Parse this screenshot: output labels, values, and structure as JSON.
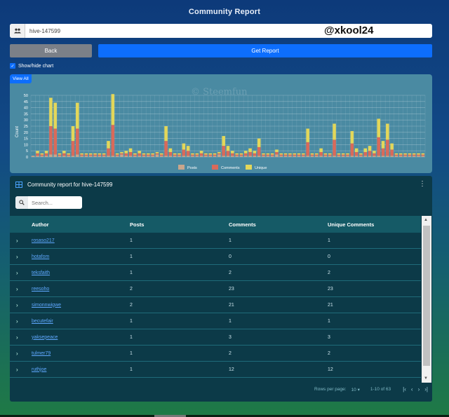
{
  "page": {
    "title": "Community Report",
    "username_overlay": "@xkool24"
  },
  "search": {
    "value": "hive-147599"
  },
  "buttons": {
    "back": "Back",
    "get_report": "Get Report"
  },
  "toggle": {
    "label": "Show/hide chart",
    "checked": true
  },
  "chart_panel": {
    "view_all": "View All",
    "watermark": "© Steemfun"
  },
  "colors": {
    "posts": "#c8a68c",
    "comments": "#d96a5a",
    "unique": "#e3d75a",
    "accent": "#0d6efd"
  },
  "chart_data": {
    "type": "bar",
    "stacked": true,
    "ylabel": "Count",
    "xlabel": "",
    "ylim": [
      0,
      50
    ],
    "yticks": [
      0,
      5,
      10,
      15,
      20,
      25,
      30,
      35,
      40,
      45,
      50
    ],
    "legend": {
      "placement": "bottom",
      "entries": [
        "Posts",
        "Comments",
        "Unique"
      ]
    },
    "grid": true,
    "series": [
      {
        "name": "Posts",
        "values": [
          1,
          1,
          1,
          1,
          2,
          2,
          1,
          1,
          1,
          1,
          2,
          1,
          1,
          1,
          1,
          1,
          1,
          1,
          1,
          1,
          2,
          1,
          1,
          1,
          1,
          1,
          1,
          1,
          2,
          1,
          1,
          1,
          1,
          1,
          1,
          1,
          1,
          1,
          1,
          1,
          1,
          1,
          2,
          1,
          1,
          1,
          1,
          1,
          1,
          1,
          1,
          1,
          1,
          1,
          1,
          2,
          1,
          1,
          1,
          1,
          1,
          1,
          1,
          1,
          1,
          1,
          1,
          1,
          1,
          1,
          1,
          1,
          1,
          1,
          1,
          1,
          1,
          1,
          1,
          1,
          1,
          1,
          1,
          1,
          1,
          1,
          1,
          1,
          1
        ]
      },
      {
        "name": "Comments",
        "values": [
          0,
          2,
          1,
          2,
          23,
          21,
          1,
          2,
          1,
          12,
          21,
          1,
          1,
          1,
          1,
          1,
          1,
          6,
          25,
          1,
          1,
          2,
          3,
          1,
          2,
          1,
          1,
          1,
          1,
          1,
          12,
          3,
          1,
          1,
          5,
          4,
          1,
          1,
          2,
          1,
          1,
          1,
          1,
          8,
          4,
          2,
          1,
          1,
          2,
          3,
          2,
          7,
          1,
          1,
          1,
          2,
          1,
          1,
          1,
          1,
          1,
          1,
          11,
          1,
          1,
          3,
          1,
          1,
          13,
          1,
          1,
          1,
          10,
          3,
          1,
          3,
          4,
          2,
          15,
          6,
          13,
          5,
          1,
          1,
          1,
          1,
          1,
          1,
          1
        ]
      },
      {
        "name": "Unique",
        "values": [
          0,
          2,
          1,
          2,
          23,
          21,
          1,
          2,
          1,
          12,
          21,
          1,
          1,
          1,
          1,
          1,
          1,
          6,
          25,
          1,
          1,
          2,
          3,
          1,
          2,
          1,
          1,
          1,
          1,
          1,
          12,
          3,
          1,
          1,
          5,
          4,
          1,
          1,
          2,
          1,
          1,
          1,
          1,
          8,
          4,
          2,
          1,
          1,
          2,
          3,
          2,
          7,
          1,
          1,
          1,
          2,
          1,
          1,
          1,
          1,
          1,
          1,
          11,
          1,
          1,
          3,
          1,
          1,
          13,
          1,
          1,
          1,
          10,
          3,
          1,
          3,
          4,
          2,
          15,
          6,
          13,
          5,
          1,
          1,
          1,
          1,
          1,
          1,
          1
        ]
      }
    ]
  },
  "report": {
    "title": "Community report for hive-147599",
    "search_placeholder": "Search...",
    "columns": [
      "Author",
      "Posts",
      "Comments",
      "Unique Comments"
    ],
    "rows": [
      {
        "author": "rosaso217",
        "posts": "1",
        "comments": "1",
        "unique": "1"
      },
      {
        "author": "hotafom",
        "posts": "1",
        "comments": "0",
        "unique": "0"
      },
      {
        "author": "teksfaith",
        "posts": "1",
        "comments": "2",
        "unique": "2"
      },
      {
        "author": "reesoho",
        "posts": "2",
        "comments": "23",
        "unique": "23"
      },
      {
        "author": "simonnwigwe",
        "posts": "2",
        "comments": "21",
        "unique": "21"
      },
      {
        "author": "becutefair",
        "posts": "1",
        "comments": "1",
        "unique": "1"
      },
      {
        "author": "yaksepeace",
        "posts": "1",
        "comments": "3",
        "unique": "3"
      },
      {
        "author": "tulmer79",
        "posts": "1",
        "comments": "2",
        "unique": "2"
      },
      {
        "author": "ruthjoe",
        "posts": "1",
        "comments": "12",
        "unique": "12"
      }
    ],
    "pagination": {
      "rows_label": "Rows per page:",
      "rows_value": "10",
      "range": "1-10 of 63"
    }
  }
}
